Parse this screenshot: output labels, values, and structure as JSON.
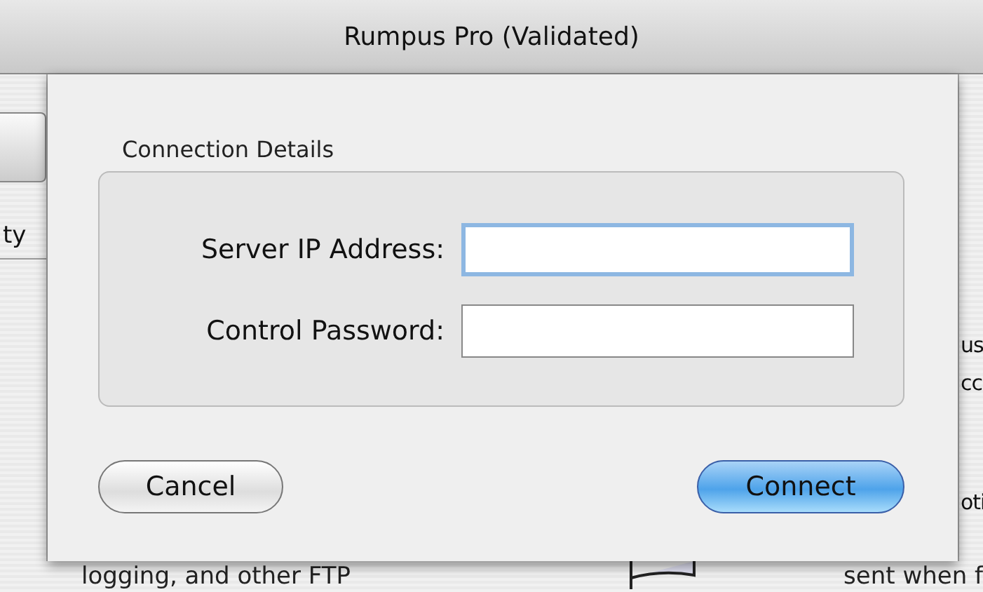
{
  "window": {
    "title": "Rumpus Pro (Validated)"
  },
  "sidebar": {
    "label": "ty"
  },
  "right_edge": [
    "us",
    "cc",
    "oti"
  ],
  "bottom_row": {
    "left": "logging, and other FTP",
    "right": "sent when f"
  },
  "sheet": {
    "group_title": "Connection Details",
    "fields": [
      {
        "label": "Server IP Address:",
        "focused": true
      },
      {
        "label": "Control Password:",
        "focused": false
      }
    ],
    "buttons": [
      {
        "label": "Cancel",
        "default": false
      },
      {
        "label": "Connect",
        "default": true
      }
    ]
  }
}
